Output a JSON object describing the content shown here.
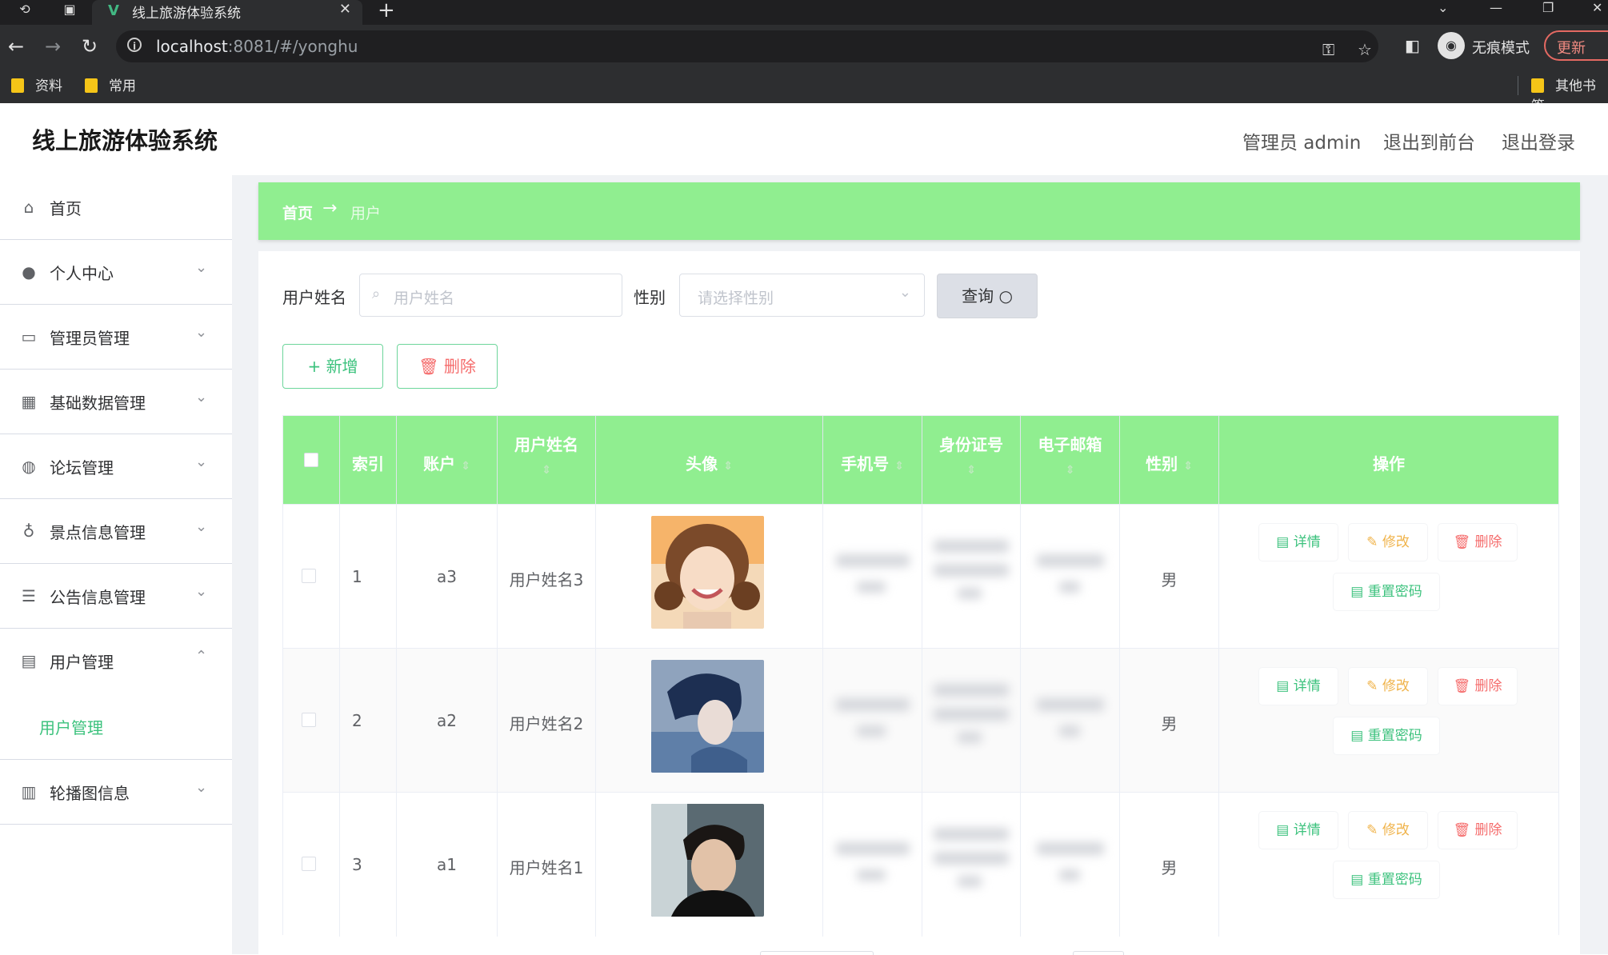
{
  "browser": {
    "tab_title": "线上旅游体验系统",
    "url_host": "localhost",
    "url_rest": ":8081/#/yonghu",
    "incognito_label": "无痕模式",
    "update_label": "更新",
    "bookmarks": [
      "资料",
      "常用"
    ],
    "other_bookmarks": "其他书签"
  },
  "header": {
    "title": "线上旅游体验系统",
    "admin_label": "管理员 admin",
    "to_front": "退出到前台",
    "logout": "退出登录"
  },
  "sidebar": {
    "items": [
      {
        "label": "首页",
        "icon": "home-icon"
      },
      {
        "label": "个人中心",
        "icon": "user-icon"
      },
      {
        "label": "管理员管理",
        "icon": "id-card-icon"
      },
      {
        "label": "基础数据管理",
        "icon": "grid-icon"
      },
      {
        "label": "论坛管理",
        "icon": "globe-icon"
      },
      {
        "label": "景点信息管理",
        "icon": "microphone-icon"
      },
      {
        "label": "公告信息管理",
        "icon": "sliders-icon"
      },
      {
        "label": "用户管理",
        "icon": "clipboard-icon"
      },
      {
        "label": "轮播图信息",
        "icon": "bar-chart-icon"
      }
    ],
    "submenu_active": "用户管理"
  },
  "breadcrumb": {
    "home": "首页",
    "arrow": "→",
    "current": "用户"
  },
  "search": {
    "name_label": "用户姓名",
    "name_placeholder": "用户姓名",
    "gender_label": "性别",
    "gender_placeholder": "请选择性别",
    "query_button": "查询"
  },
  "actions": {
    "add": "新增",
    "delete": "删除"
  },
  "table": {
    "headers": [
      "索引",
      "账户",
      "用户姓名",
      "头像",
      "手机号",
      "身份证号",
      "电子邮箱",
      "性别",
      "操作"
    ],
    "rows": [
      {
        "index": "1",
        "account": "a3",
        "name": "用户姓名3",
        "gender": "男"
      },
      {
        "index": "2",
        "account": "a2",
        "name": "用户姓名2",
        "gender": "男"
      },
      {
        "index": "3",
        "account": "a1",
        "name": "用户姓名1",
        "gender": "男"
      }
    ],
    "ops": {
      "detail": "详情",
      "edit": "修改",
      "delete": "删除",
      "reset": "重置密码"
    }
  },
  "colors": {
    "accent": "#90ee90",
    "primary_text": "#3cc27d",
    "danger": "#f56c6c",
    "warning": "#f0b34a"
  }
}
